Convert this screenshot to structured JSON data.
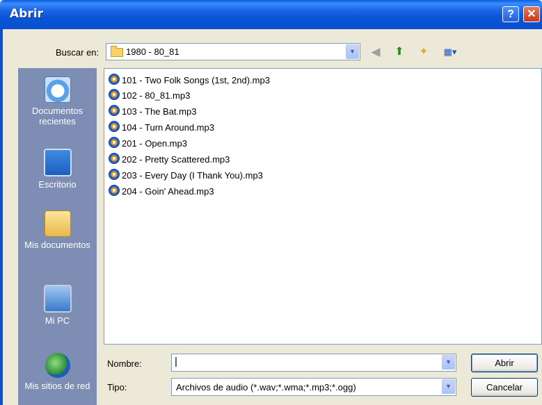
{
  "window": {
    "title": "Abrir",
    "help_glyph": "?",
    "close_glyph": "✕"
  },
  "toolbar": {
    "lookin_label": "Buscar en:",
    "lookin_value": "1980 - 80_81",
    "icons": [
      "back-icon",
      "up-folder-icon",
      "new-folder-icon",
      "views-menu-icon"
    ]
  },
  "places": [
    {
      "label": "Documentos recientes",
      "icon": "recent-documents-icon"
    },
    {
      "label": "Escritorio",
      "icon": "desktop-icon"
    },
    {
      "label": "Mis documentos",
      "icon": "my-documents-icon"
    },
    {
      "label": "Mi PC",
      "icon": "my-computer-icon"
    },
    {
      "label": "Mis sitios de red",
      "icon": "network-places-icon"
    }
  ],
  "files": [
    "101 - Two Folk Songs (1st, 2nd).mp3",
    "102 - 80_81.mp3",
    "103 - The Bat.mp3",
    "104 - Turn Around.mp3",
    "201 - Open.mp3",
    "202 - Pretty Scattered.mp3",
    "203 - Every Day (I Thank You).mp3",
    "204 - Goin' Ahead.mp3"
  ],
  "form": {
    "name_label": "Nombre:",
    "name_value": "",
    "type_label": "Tipo:",
    "type_value": "Archivos de audio (*.wav;*.wma;*.mp3;*.ogg)"
  },
  "buttons": {
    "open": "Abrir",
    "cancel": "Cancelar"
  },
  "colors": {
    "titlebar": "#0A54D8",
    "places_bar": "#7D8DB3",
    "dialog_bg": "#ECE9D8"
  }
}
